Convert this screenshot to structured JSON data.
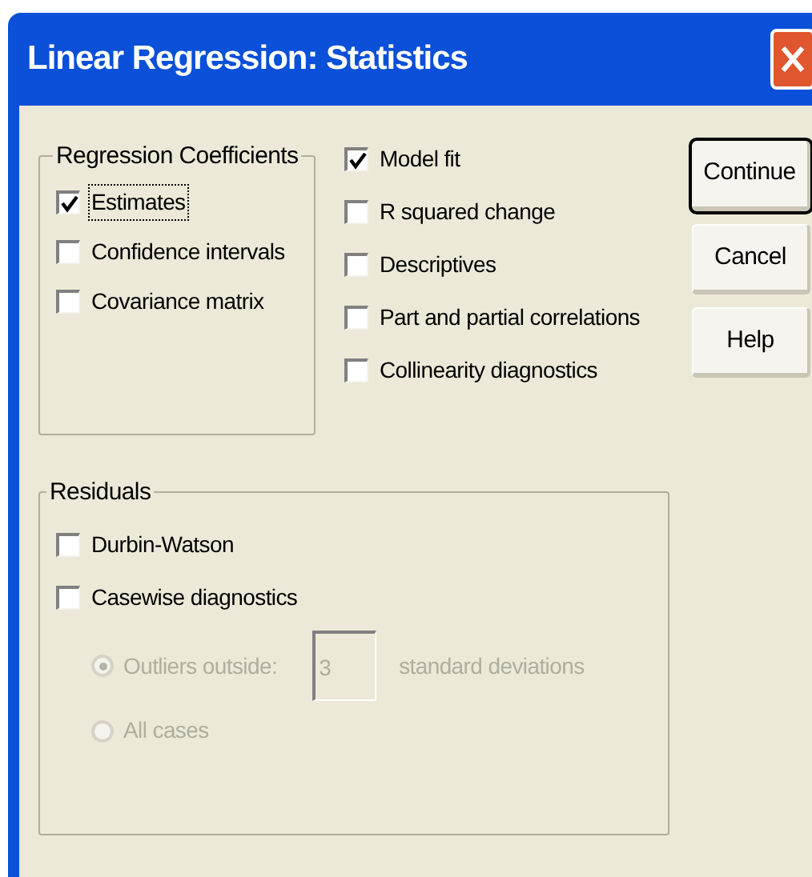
{
  "window": {
    "title": "Linear Regression: Statistics"
  },
  "regression_coefficients": {
    "label": "Regression Coefficients",
    "options": [
      {
        "label": "Estimates",
        "checked": true,
        "focused": true
      },
      {
        "label": "Confidence intervals",
        "checked": false,
        "focused": false
      },
      {
        "label": "Covariance matrix",
        "checked": false,
        "focused": false
      }
    ]
  },
  "model_options": [
    {
      "label": "Model fit",
      "checked": true
    },
    {
      "label": "R squared change",
      "checked": false
    },
    {
      "label": "Descriptives",
      "checked": false
    },
    {
      "label": "Part and partial correlations",
      "checked": false
    },
    {
      "label": "Collinearity diagnostics",
      "checked": false
    }
  ],
  "buttons": [
    {
      "label": "Continue",
      "default": true
    },
    {
      "label": "Cancel",
      "default": false
    },
    {
      "label": "Help",
      "default": false
    }
  ],
  "residuals": {
    "label": "Residuals",
    "options": [
      {
        "label": "Durbin-Watson",
        "checked": false
      },
      {
        "label": "Casewise diagnostics",
        "checked": false
      }
    ],
    "casewise": {
      "radios": [
        {
          "label": "Outliers outside:",
          "selected": true,
          "disabled": true
        },
        {
          "label": "All cases",
          "selected": false,
          "disabled": true
        }
      ],
      "field": {
        "value": "3",
        "disabled": true
      },
      "unit": "standard deviations"
    }
  }
}
